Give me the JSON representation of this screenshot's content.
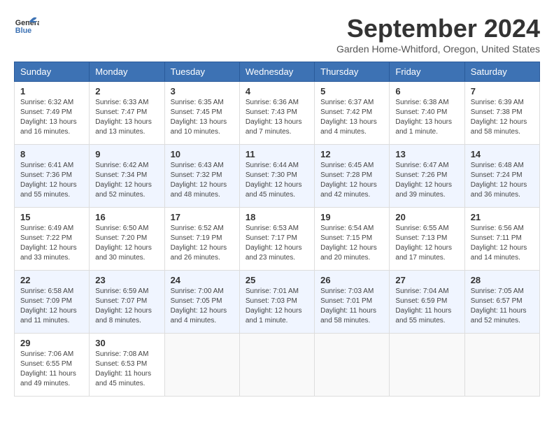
{
  "header": {
    "logo_line1": "General",
    "logo_line2": "Blue",
    "title": "September 2024",
    "subtitle": "Garden Home-Whitford, Oregon, United States"
  },
  "calendar": {
    "days_of_week": [
      "Sunday",
      "Monday",
      "Tuesday",
      "Wednesday",
      "Thursday",
      "Friday",
      "Saturday"
    ],
    "weeks": [
      [
        {
          "day": "",
          "info": ""
        },
        {
          "day": "2",
          "info": "Sunrise: 6:33 AM\nSunset: 7:47 PM\nDaylight: 13 hours\nand 13 minutes."
        },
        {
          "day": "3",
          "info": "Sunrise: 6:35 AM\nSunset: 7:45 PM\nDaylight: 13 hours\nand 10 minutes."
        },
        {
          "day": "4",
          "info": "Sunrise: 6:36 AM\nSunset: 7:43 PM\nDaylight: 13 hours\nand 7 minutes."
        },
        {
          "day": "5",
          "info": "Sunrise: 6:37 AM\nSunset: 7:42 PM\nDaylight: 13 hours\nand 4 minutes."
        },
        {
          "day": "6",
          "info": "Sunrise: 6:38 AM\nSunset: 7:40 PM\nDaylight: 13 hours\nand 1 minute."
        },
        {
          "day": "7",
          "info": "Sunrise: 6:39 AM\nSunset: 7:38 PM\nDaylight: 12 hours\nand 58 minutes."
        }
      ],
      [
        {
          "day": "8",
          "info": "Sunrise: 6:41 AM\nSunset: 7:36 PM\nDaylight: 12 hours\nand 55 minutes."
        },
        {
          "day": "9",
          "info": "Sunrise: 6:42 AM\nSunset: 7:34 PM\nDaylight: 12 hours\nand 52 minutes."
        },
        {
          "day": "10",
          "info": "Sunrise: 6:43 AM\nSunset: 7:32 PM\nDaylight: 12 hours\nand 48 minutes."
        },
        {
          "day": "11",
          "info": "Sunrise: 6:44 AM\nSunset: 7:30 PM\nDaylight: 12 hours\nand 45 minutes."
        },
        {
          "day": "12",
          "info": "Sunrise: 6:45 AM\nSunset: 7:28 PM\nDaylight: 12 hours\nand 42 minutes."
        },
        {
          "day": "13",
          "info": "Sunrise: 6:47 AM\nSunset: 7:26 PM\nDaylight: 12 hours\nand 39 minutes."
        },
        {
          "day": "14",
          "info": "Sunrise: 6:48 AM\nSunset: 7:24 PM\nDaylight: 12 hours\nand 36 minutes."
        }
      ],
      [
        {
          "day": "15",
          "info": "Sunrise: 6:49 AM\nSunset: 7:22 PM\nDaylight: 12 hours\nand 33 minutes."
        },
        {
          "day": "16",
          "info": "Sunrise: 6:50 AM\nSunset: 7:20 PM\nDaylight: 12 hours\nand 30 minutes."
        },
        {
          "day": "17",
          "info": "Sunrise: 6:52 AM\nSunset: 7:19 PM\nDaylight: 12 hours\nand 26 minutes."
        },
        {
          "day": "18",
          "info": "Sunrise: 6:53 AM\nSunset: 7:17 PM\nDaylight: 12 hours\nand 23 minutes."
        },
        {
          "day": "19",
          "info": "Sunrise: 6:54 AM\nSunset: 7:15 PM\nDaylight: 12 hours\nand 20 minutes."
        },
        {
          "day": "20",
          "info": "Sunrise: 6:55 AM\nSunset: 7:13 PM\nDaylight: 12 hours\nand 17 minutes."
        },
        {
          "day": "21",
          "info": "Sunrise: 6:56 AM\nSunset: 7:11 PM\nDaylight: 12 hours\nand 14 minutes."
        }
      ],
      [
        {
          "day": "22",
          "info": "Sunrise: 6:58 AM\nSunset: 7:09 PM\nDaylight: 12 hours\nand 11 minutes."
        },
        {
          "day": "23",
          "info": "Sunrise: 6:59 AM\nSunset: 7:07 PM\nDaylight: 12 hours\nand 8 minutes."
        },
        {
          "day": "24",
          "info": "Sunrise: 7:00 AM\nSunset: 7:05 PM\nDaylight: 12 hours\nand 4 minutes."
        },
        {
          "day": "25",
          "info": "Sunrise: 7:01 AM\nSunset: 7:03 PM\nDaylight: 12 hours\nand 1 minute."
        },
        {
          "day": "26",
          "info": "Sunrise: 7:03 AM\nSunset: 7:01 PM\nDaylight: 11 hours\nand 58 minutes."
        },
        {
          "day": "27",
          "info": "Sunrise: 7:04 AM\nSunset: 6:59 PM\nDaylight: 11 hours\nand 55 minutes."
        },
        {
          "day": "28",
          "info": "Sunrise: 7:05 AM\nSunset: 6:57 PM\nDaylight: 11 hours\nand 52 minutes."
        }
      ],
      [
        {
          "day": "29",
          "info": "Sunrise: 7:06 AM\nSunset: 6:55 PM\nDaylight: 11 hours\nand 49 minutes."
        },
        {
          "day": "30",
          "info": "Sunrise: 7:08 AM\nSunset: 6:53 PM\nDaylight: 11 hours\nand 45 minutes."
        },
        {
          "day": "",
          "info": ""
        },
        {
          "day": "",
          "info": ""
        },
        {
          "day": "",
          "info": ""
        },
        {
          "day": "",
          "info": ""
        },
        {
          "day": "",
          "info": ""
        }
      ]
    ],
    "week1_special": [
      {
        "day": "1",
        "info": "Sunrise: 6:32 AM\nSunset: 7:49 PM\nDaylight: 13 hours\nand 16 minutes."
      }
    ]
  }
}
